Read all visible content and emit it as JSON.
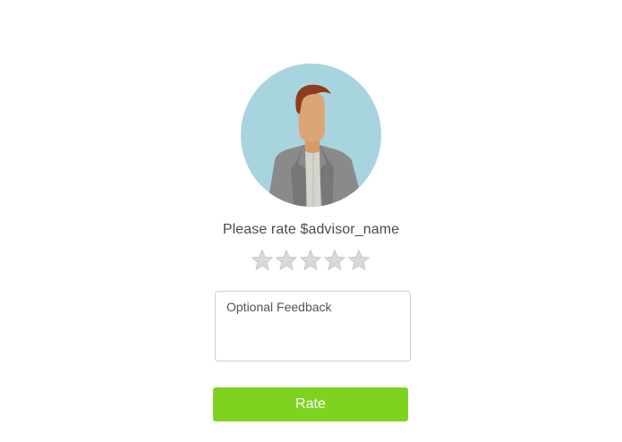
{
  "rating": {
    "prompt_text": "Please rate $advisor_name",
    "stars_total": 5,
    "stars_selected": 0,
    "star_icon": "star-outline-icon",
    "star_color": "#d9d9d9"
  },
  "avatar": {
    "icon": "advisor-avatar-icon",
    "background_color": "#a8d4df"
  },
  "feedback": {
    "placeholder": "Optional Feedback",
    "value": ""
  },
  "actions": {
    "rate_label": "Rate",
    "rate_color": "#7ed321"
  }
}
